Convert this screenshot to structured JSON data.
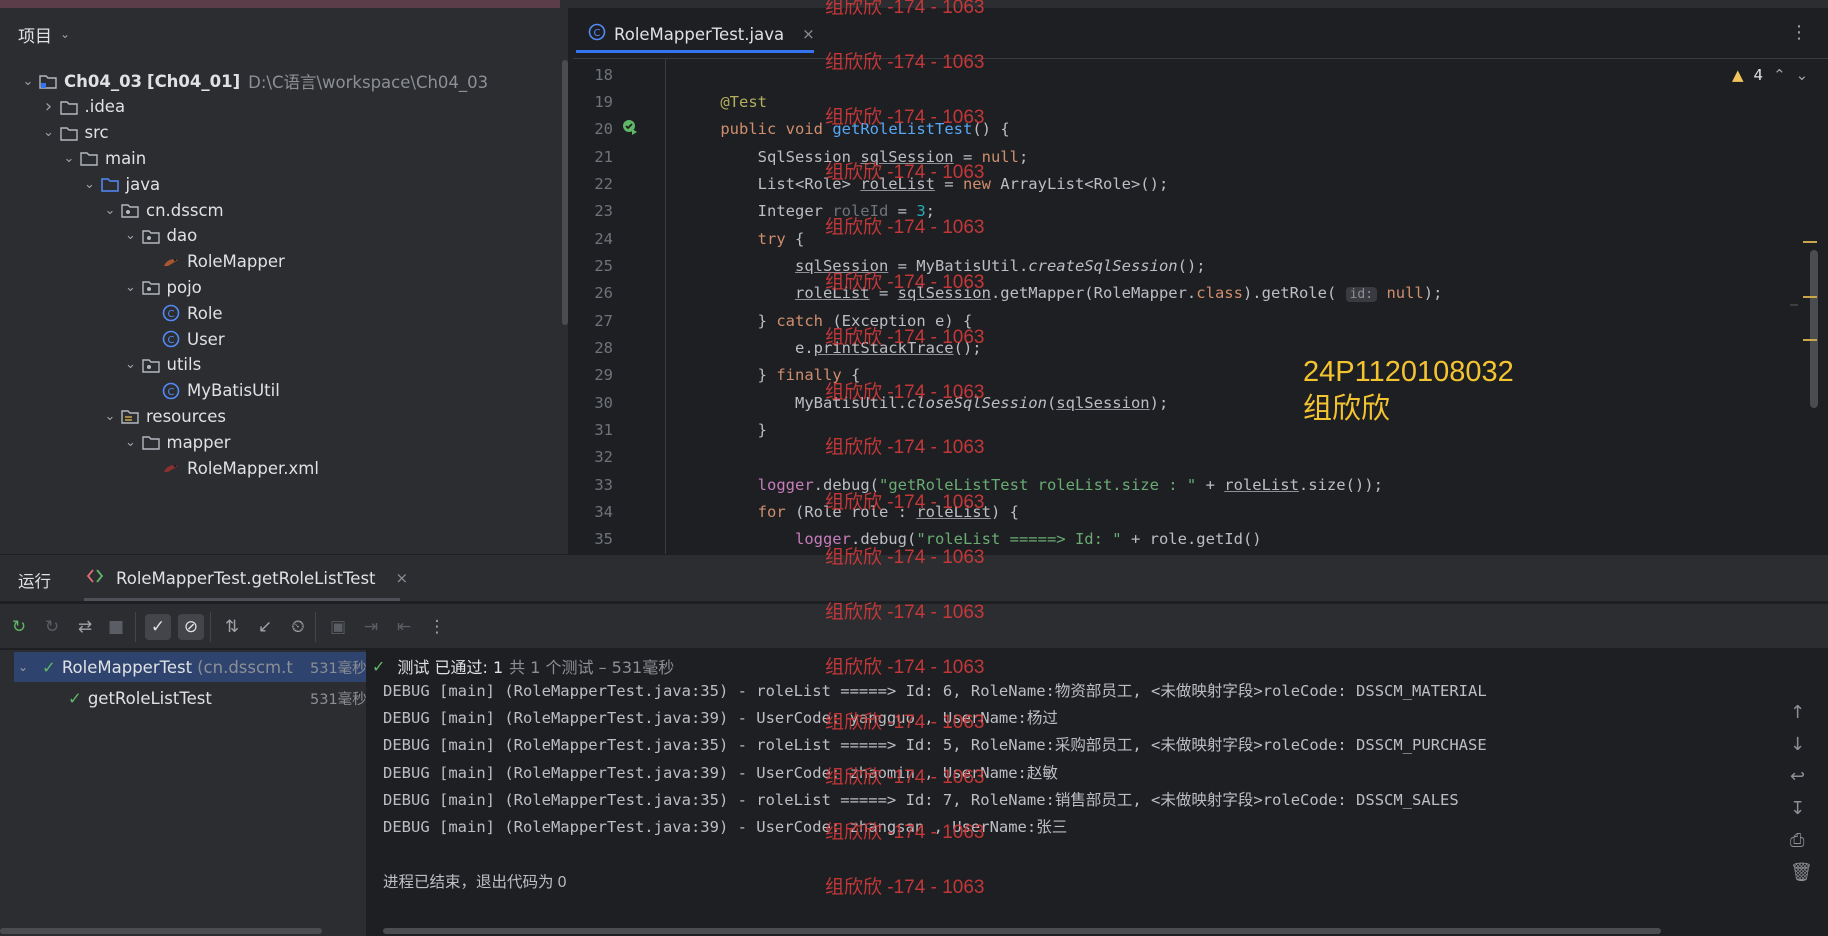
{
  "project": {
    "header": "项目",
    "tree": [
      {
        "name": "Ch04_03",
        "module": "[Ch04_01]",
        "path": "D:\\C语言\\workspace\\Ch04_03",
        "icon": "module-icon",
        "level": 0,
        "expanded": true
      },
      {
        "name": ".idea",
        "icon": "folder-icon",
        "level": 1,
        "expanded": false
      },
      {
        "name": "src",
        "icon": "folder-icon",
        "level": 1,
        "expanded": true
      },
      {
        "name": "main",
        "icon": "folder-icon",
        "level": 2,
        "expanded": true
      },
      {
        "name": "java",
        "icon": "source-folder-icon",
        "level": 3,
        "expanded": true
      },
      {
        "name": "cn.dsscm",
        "icon": "package-icon",
        "level": 4,
        "expanded": true
      },
      {
        "name": "dao",
        "icon": "package-icon",
        "level": 5,
        "expanded": true
      },
      {
        "name": "RoleMapper",
        "icon": "mybatis-mapper-icon",
        "level": 6
      },
      {
        "name": "pojo",
        "icon": "package-icon",
        "level": 5,
        "expanded": true
      },
      {
        "name": "Role",
        "icon": "class-icon",
        "level": 6
      },
      {
        "name": "User",
        "icon": "class-icon",
        "level": 6
      },
      {
        "name": "utils",
        "icon": "package-icon",
        "level": 5,
        "expanded": true
      },
      {
        "name": "MyBatisUtil",
        "icon": "class-icon",
        "level": 6
      },
      {
        "name": "resources",
        "icon": "resources-folder-icon",
        "level": 4,
        "expanded": true
      },
      {
        "name": "mapper",
        "icon": "folder-icon",
        "level": 5,
        "expanded": true
      },
      {
        "name": "RoleMapper.xml",
        "icon": "mybatis-xml-icon",
        "level": 6
      }
    ]
  },
  "editor": {
    "tab_label": "RoleMapperTest.java",
    "tab_close": "×",
    "more_icon": "⋮",
    "warnings": "4",
    "lines": [
      {
        "n": "18",
        "text": ""
      },
      {
        "n": "19",
        "text": "    @Test"
      },
      {
        "n": "20",
        "text": "    public void getRoleListTest() {"
      },
      {
        "n": "21",
        "text": "        SqlSession sqlSession = null;"
      },
      {
        "n": "22",
        "text": "        List<Role> roleList = new ArrayList<Role>();"
      },
      {
        "n": "23",
        "text": "        Integer roleId = 3;"
      },
      {
        "n": "24",
        "text": "        try {"
      },
      {
        "n": "25",
        "text": "            sqlSession = MyBatisUtil.createSqlSession();"
      },
      {
        "n": "26",
        "text": "            roleList = sqlSession.getMapper(RoleMapper.class).getRole( id: null);"
      },
      {
        "n": "27",
        "text": "        } catch (Exception e) {"
      },
      {
        "n": "28",
        "text": "            e.printStackTrace();"
      },
      {
        "n": "29",
        "text": "        } finally {"
      },
      {
        "n": "30",
        "text": "            MyBatisUtil.closeSqlSession(sqlSession);"
      },
      {
        "n": "31",
        "text": "        }"
      },
      {
        "n": "32",
        "text": ""
      },
      {
        "n": "33",
        "text": "        logger.debug(\"getRoleListTest roleList.size : \" + roleList.size());"
      },
      {
        "n": "34",
        "text": "        for (Role role : roleList) {"
      },
      {
        "n": "35",
        "text": "            logger.debug(\"roleList =====> Id: \" + role.getId()"
      }
    ]
  },
  "run": {
    "label": "运行",
    "tab_label": "RoleMapperTest.getRoleListTest",
    "tab_close": "×",
    "toolbar_icons": [
      "rerun-icon",
      "rerun-failed-icon",
      "toggle-auto-test-icon",
      "stop-icon",
      "show-passed-icon",
      "show-ignored-icon",
      "sort-icon",
      "collapse-icon",
      "history-icon",
      "screenshot-icon",
      "import-icon",
      "export-icon",
      "more-icon"
    ],
    "tests": [
      {
        "name": "RoleMapperTest",
        "pkg": "(cn.dsscm.t",
        "time": "531毫秒"
      },
      {
        "name": "getRoleListTest",
        "time": "531毫秒"
      }
    ],
    "status_label": "测试 已通过: 1",
    "status_detail": "共 1 个测试 – 531毫秒",
    "console": [
      "DEBUG [main] (RoleMapperTest.java:35) - roleList =====> Id: 6, RoleName:物资部员工, <未做映射字段>roleCode: DSSCM_MATERIAL",
      "DEBUG [main] (RoleMapperTest.java:39) - UserCode: yangguo , UserName:杨过",
      "DEBUG [main] (RoleMapperTest.java:35) - roleList =====> Id: 5, RoleName:采购部员工, <未做映射字段>roleCode: DSSCM_PURCHASE",
      "DEBUG [main] (RoleMapperTest.java:39) - UserCode: zhaomin , UserName:赵敏",
      "DEBUG [main] (RoleMapperTest.java:35) - roleList =====> Id: 7, RoleName:销售部员工, <未做映射字段>roleCode: DSSCM_SALES",
      "DEBUG [main] (RoleMapperTest.java:39) - UserCode: zhangsan , UserName:张三",
      "",
      "进程已结束，退出代码为 0"
    ]
  },
  "overlay": {
    "watermark": "组欣欣 -174 - 1063",
    "student_id": "24P1120108032",
    "student_name": "组欣欣"
  },
  "colors": {
    "accent": "#3574f0",
    "pass": "#5fb865",
    "watermark": "#d13a3a",
    "stamp": "#f4c430"
  }
}
